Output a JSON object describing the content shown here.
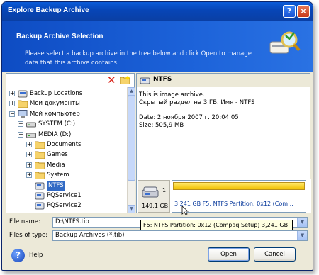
{
  "window": {
    "title": "Explore Backup Archive",
    "help_glyph": "?",
    "close_glyph": "×"
  },
  "header": {
    "title": "Backup Archive Selection",
    "description": "Please select a backup archive in the tree below and click Open to manage data that this archive contains."
  },
  "tree": {
    "items": [
      {
        "label": "Backup Locations",
        "expander": "+",
        "icon": "backup-locations-icon",
        "depth": 0
      },
      {
        "label": "Мои документы",
        "expander": "+",
        "icon": "folder-icon",
        "depth": 0
      },
      {
        "label": "Мой компьютер",
        "expander": "−",
        "icon": "computer-icon",
        "depth": 0
      },
      {
        "label": "SYSTEM (C:)",
        "expander": "+",
        "icon": "drive-icon",
        "depth": 1
      },
      {
        "label": "MEDIA (D:)",
        "expander": "−",
        "icon": "drive-icon",
        "depth": 1
      },
      {
        "label": "Documents",
        "expander": "+",
        "icon": "folder-icon",
        "depth": 2
      },
      {
        "label": "Games",
        "expander": "+",
        "icon": "folder-icon",
        "depth": 2
      },
      {
        "label": "Media",
        "expander": "+",
        "icon": "folder-icon",
        "depth": 2
      },
      {
        "label": "System",
        "expander": "+",
        "icon": "folder-icon",
        "depth": 2
      },
      {
        "label": "NTFS",
        "expander": "",
        "icon": "archive-icon",
        "depth": 2,
        "selected": true
      },
      {
        "label": "PQService1",
        "expander": "",
        "icon": "archive-icon",
        "depth": 2
      },
      {
        "label": "PQService2",
        "expander": "",
        "icon": "archive-icon",
        "depth": 2
      }
    ]
  },
  "info": {
    "name": "NTFS",
    "line1": "This is image archive.",
    "line2": "Скрытый раздел на 3 ГБ. Имя - NTFS",
    "date": "Date: 2 ноября 2007 г. 20:04:05",
    "size": "Size: 505,9 MB"
  },
  "disk": {
    "number": "1",
    "size": "149,1 GB",
    "partition_label": "3,241 GB  F5: NTFS Partition: 0x12 (Com..."
  },
  "file_name": {
    "label": "File name:",
    "value": "D:\\NTFS.tib"
  },
  "file_type": {
    "label": "Files of type:",
    "value": "Backup Archives (*.tib)"
  },
  "tooltip": "F5: NTFS Partition: 0x12 (Compaq Setup) 3,241 GB",
  "buttons": {
    "help": "Help",
    "open": "Open",
    "cancel": "Cancel"
  }
}
